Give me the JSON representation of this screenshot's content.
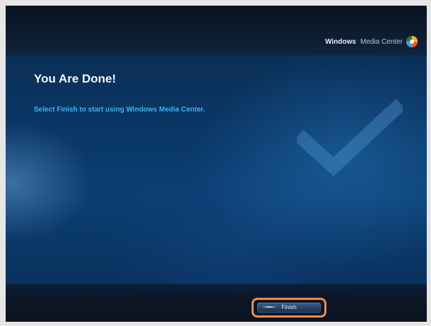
{
  "app": {
    "brand_strong": "Windows",
    "brand_light": "Media Center",
    "logo_icon": "windows-media-center-logo-icon"
  },
  "content": {
    "title": "You Are Done!",
    "instruction": "Select Finish to start using Windows Media Center.",
    "decor_icon": "checkmark-icon"
  },
  "actions": {
    "finish_label": "Finish"
  },
  "colors": {
    "accent_text": "#3fb4ef",
    "title_text": "#f2f5f8",
    "highlight_ring": "#f08d4c",
    "background": "#0a3563"
  }
}
